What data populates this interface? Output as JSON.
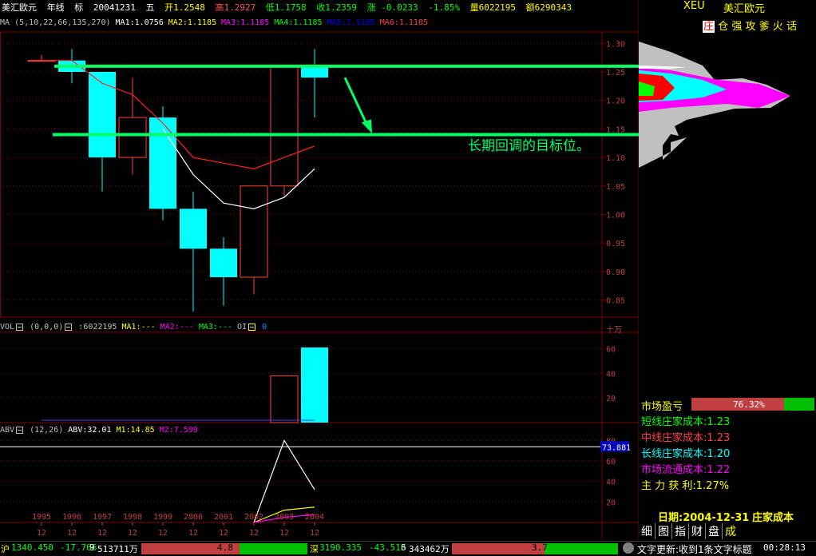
{
  "header": {
    "name": "美汇欧元",
    "period": "年线",
    "mark": "标",
    "date": "20041231",
    "weekday": "五",
    "open": "开1.2548",
    "high": "高1.2927",
    "low": "低1.1758",
    "close": "收1.2359",
    "change": "涨 -0.0233",
    "pct": "-1.85%",
    "volume": "量6022195",
    "amount": "额6290343",
    "symbol": "XEU",
    "symbol_name": "美汇欧元"
  },
  "ma_legend": {
    "label": "MA",
    "params": "(5,10,22,66,135,270)",
    "ma1": "MA1:1.0756",
    "ma2": "MA2:1.1185",
    "ma3": "MA3:1.1185",
    "ma4": "MA4:1.1185",
    "ma5": "MA5:1.1185",
    "ma6": "MA6:1.1185"
  },
  "vol_legend": {
    "label": "VOL",
    "params": "(0,0,0)",
    "value": ":6022195",
    "ma1": "MA1:---",
    "ma2": "MA2:---",
    "ma3": "MA3:---",
    "oi": "OI",
    "oi_val": "0"
  },
  "abv_legend": {
    "label": "ABV",
    "params": "(12,26)",
    "abv": "ABV:32.01",
    "m1": "M1:14.85",
    "m2": "M2:7.599",
    "badge": "73.881"
  },
  "top_tabs": [
    "庄",
    "仓",
    "强",
    "攻",
    "爹",
    "火",
    "话"
  ],
  "annotation": "长期回调的目标位。",
  "price_axis": [
    "1.30",
    "1.25",
    "1.20",
    "1.15",
    "1.10",
    "1.05",
    "1.00",
    "0.95",
    "0.90",
    "0.85"
  ],
  "vol_axis": [
    "十万",
    "60",
    "40",
    "20"
  ],
  "abv_axis": [
    "80",
    "60",
    "40",
    "20"
  ],
  "years": [
    "1995",
    "1996",
    "1997",
    "1998",
    "1999",
    "2000",
    "2001",
    "2002",
    "2003",
    "2004"
  ],
  "months": [
    "12",
    "12",
    "12",
    "12",
    "12",
    "12",
    "12",
    "12",
    "12",
    "12"
  ],
  "side": {
    "market_label": "市场盈亏",
    "market_value": "76.32%",
    "short_cost": "短线庄家成本:1.23",
    "mid_cost": "中线庄家成本:1.23",
    "long_cost": "长线庄家成本:1.20",
    "float_cost": "市场流通成本:1.22",
    "profit": "主 力  获 利:1.27%",
    "date": "日期:2004-12-31",
    "cost_title": "庄家成本"
  },
  "bottom_tabs": [
    "细",
    "图",
    "指",
    "财",
    "盘",
    "成"
  ],
  "status": {
    "sh_label": "沪",
    "sh_index": "1340.450",
    "sh_change": "-17.766",
    "sh_count": "9",
    "sh_amount": "513711万",
    "sh_bar": "4.8",
    "sz_label": "深",
    "sz_index": "3190.335",
    "sz_change": "-43.513",
    "sz_count": "6",
    "sz_amount": "343462万",
    "sz_bar": "3.7",
    "news": "文字更新:收到1条文字标题",
    "time": "00:28:13"
  },
  "chart_data": {
    "type": "candlestick",
    "title": "美汇欧元 年线",
    "categories": [
      "1995",
      "1996",
      "1997",
      "1998",
      "1999",
      "2000",
      "2001",
      "2002",
      "2003",
      "2004"
    ],
    "ohlc": [
      {
        "open": 1.27,
        "high": 1.28,
        "low": 1.27,
        "close": 1.27
      },
      {
        "open": 1.27,
        "high": 1.29,
        "low": 1.23,
        "close": 1.25
      },
      {
        "open": 1.25,
        "high": 1.25,
        "low": 1.04,
        "close": 1.1
      },
      {
        "open": 1.1,
        "high": 1.24,
        "low": 1.07,
        "close": 1.17
      },
      {
        "open": 1.17,
        "high": 1.19,
        "low": 0.99,
        "close": 1.01
      },
      {
        "open": 1.01,
        "high": 1.04,
        "low": 0.83,
        "close": 0.94
      },
      {
        "open": 0.94,
        "high": 0.96,
        "low": 0.84,
        "close": 0.89
      },
      {
        "open": 0.89,
        "high": 1.05,
        "low": 0.86,
        "close": 1.05
      },
      {
        "open": 1.05,
        "high": 1.26,
        "low": 1.03,
        "close": 1.26
      },
      {
        "open": 1.26,
        "high": 1.29,
        "low": 1.17,
        "close": 1.24
      }
    ],
    "ma_red": [
      1.27,
      1.27,
      1.23,
      1.21,
      1.16,
      1.1,
      1.09,
      1.08,
      1.1,
      1.12
    ],
    "ma_white": [
      null,
      null,
      null,
      null,
      1.15,
      1.07,
      1.02,
      1.01,
      1.03,
      1.08
    ],
    "volume": [
      0,
      0,
      0,
      0,
      0,
      0,
      0,
      0,
      38,
      61
    ],
    "abv": [
      null,
      null,
      null,
      null,
      null,
      null,
      null,
      0,
      80,
      32
    ],
    "m1": [
      null,
      null,
      null,
      null,
      null,
      null,
      null,
      0,
      12,
      15
    ],
    "m2": [
      null,
      null,
      null,
      null,
      null,
      null,
      null,
      0,
      5,
      7.6
    ],
    "levels": [
      1.26,
      1.14
    ],
    "price_range": [
      0.82,
      1.32
    ],
    "volume_range": [
      0,
      72
    ],
    "abv_range": [
      0,
      85
    ]
  }
}
